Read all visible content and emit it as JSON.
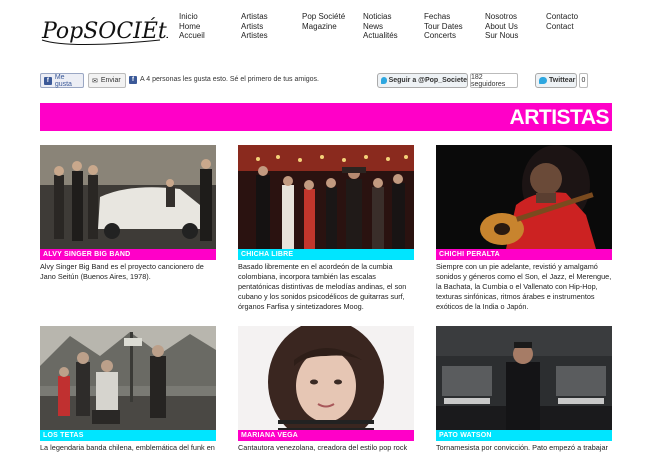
{
  "brand": {
    "logo_text": "PopSOCIÉtÉ"
  },
  "nav": [
    {
      "lines": [
        "Inicio",
        "Home",
        "Accueil"
      ]
    },
    {
      "lines": [
        "Artistas",
        "Artists",
        "Artistes"
      ]
    },
    {
      "lines": [
        "Pop Société",
        "Magazine"
      ]
    },
    {
      "lines": [
        "Noticias",
        "News",
        "Actualités"
      ]
    },
    {
      "lines": [
        "Fechas",
        "Tour Dates",
        "Concerts"
      ]
    },
    {
      "lines": [
        "Nosotros",
        "About Us",
        "Sur Nous"
      ]
    },
    {
      "lines": [
        "Contacto",
        "Contact"
      ]
    }
  ],
  "social": {
    "like_label": "Me gusta",
    "send_label": "Enviar",
    "like_text": "A 4 personas les gusta esto. Sé el primero de tus amigos.",
    "follow_label": "Seguir a @Pop_Societe",
    "followers": "182 seguidores",
    "tweet_label": "Twittear",
    "tweet_count": "0"
  },
  "banner": {
    "title": "ARTISTAS"
  },
  "colors": {
    "accent_pink": "#ff00c8",
    "accent_cyan": "#00e5ff"
  },
  "artists": [
    {
      "name": "ALVY SINGER BIG BAND",
      "bar": "pink",
      "desc": "Alvy Singer Big Band es el proyecto cancionero de Jano Seitún (Buenos Aires, 1978)."
    },
    {
      "name": "CHICHA LIBRE",
      "bar": "cyan",
      "desc": "Basado libremente en el acordeón de la cumbia colombiana, incorpora también las escalas pentatónicas distintivas de melodías andinas, el son cubano y los sonidos psicodélicos de guitarras surf, órganos Farfisa y sintetizadores Moog."
    },
    {
      "name": "CHICHI PERALTA",
      "bar": "pink",
      "desc": "Siempre con un pie adelante, revistió y amalgamó sonidos y géneros como el Son, el Jazz, el Merengue, la Bachata, la Cumbia o el Vallenato con Hip-Hop, texturas sinfónicas, ritmos árabes e instrumentos exóticos de la India o Japón."
    },
    {
      "name": "LOS TETAS",
      "bar": "cyan",
      "desc": "La legendaria banda chilena, emblemática del funk en"
    },
    {
      "name": "MARIANA VEGA",
      "bar": "pink",
      "desc": "Cantautora venezolana, creadora del estilo pop rock"
    },
    {
      "name": "PATO WATSON",
      "bar": "cyan",
      "desc": "Tornamesista por convicción. Pato empezó a trabajar"
    }
  ]
}
